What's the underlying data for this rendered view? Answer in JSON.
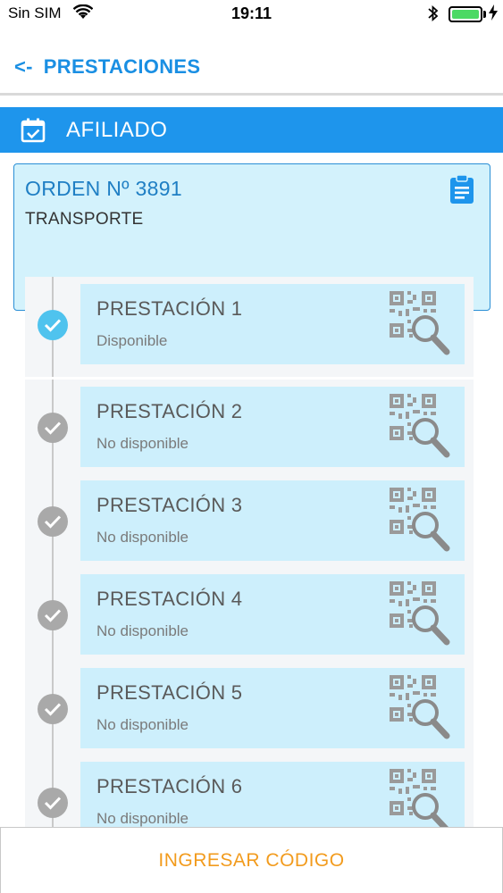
{
  "status_bar": {
    "carrier": "Sin SIM",
    "time": "19:11",
    "battery_level": 1.0
  },
  "nav": {
    "back_arrow": "<-",
    "title": "PRESTACIONES"
  },
  "section": {
    "title": "AFILIADO",
    "icon": "calendar-check-icon"
  },
  "order": {
    "title": "ORDEN Nº 3891",
    "subtitle": "TRANSPORTE",
    "icon": "clipboard-icon"
  },
  "prestaciones": [
    {
      "title": "PRESTACIÓN 1",
      "status": "Disponible",
      "available": true
    },
    {
      "title": "PRESTACIÓN 2",
      "status": "No disponible",
      "available": false
    },
    {
      "title": "PRESTACIÓN 3",
      "status": "No disponible",
      "available": false
    },
    {
      "title": "PRESTACIÓN 4",
      "status": "No disponible",
      "available": false
    },
    {
      "title": "PRESTACIÓN 5",
      "status": "No disponible",
      "available": false
    },
    {
      "title": "PRESTACIÓN 6",
      "status": "No disponible",
      "available": false
    }
  ],
  "bottom_button": {
    "label": "INGRESAR CÓDIGO"
  },
  "colors": {
    "accent": "#1e95ec",
    "available_check": "#4fc3ee",
    "unavailable_check": "#a9a9a9",
    "button_text": "#f29b1d"
  }
}
